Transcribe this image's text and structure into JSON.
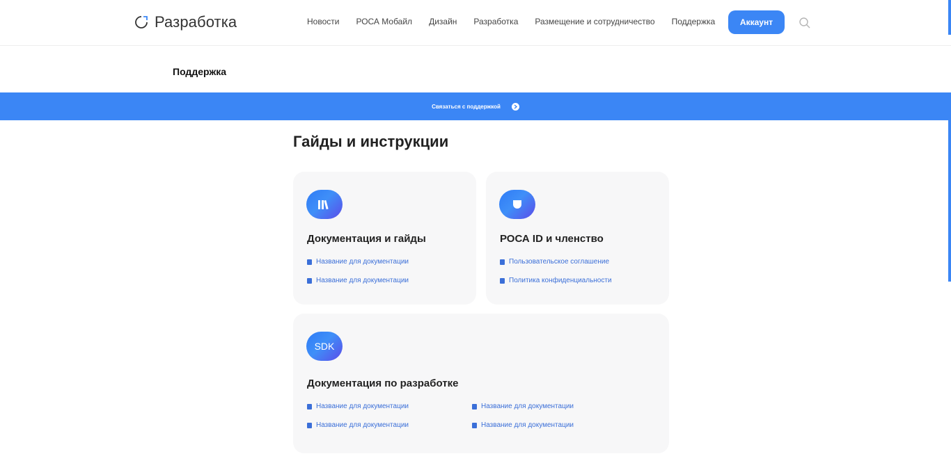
{
  "header": {
    "logo_text": "Разработка",
    "nav": [
      "Новости",
      "РОСА Мобайл",
      "Дизайн",
      "Разработка",
      "Размещение и сотрудничество",
      "Поддержка"
    ],
    "account_label": "Аккаунт",
    "search_icon": "search-icon"
  },
  "page": {
    "title": "Поддержка"
  },
  "banner": {
    "label": "Связаться с поддержкой"
  },
  "guides": {
    "title": "Гайды и инструкции",
    "cards": [
      {
        "title": "Документация и гайды",
        "icon": "books-icon",
        "links": [
          "Название для документации",
          "Название для документации"
        ]
      },
      {
        "title": "РОСА ID и членство",
        "icon": "rosa-id-icon",
        "links": [
          "Пользовательское соглашение",
          "Политика конфиденциальности"
        ]
      },
      {
        "title": "Документация по разработке",
        "icon": "sdk-icon",
        "icon_text": "SDK",
        "links": [
          "Название для документации",
          "Название для документации",
          "Название для документации",
          "Название для документации"
        ]
      }
    ]
  },
  "colors": {
    "accent": "#3b86f5",
    "link": "#3b6fd8",
    "card_bg": "#f7f7f8"
  }
}
